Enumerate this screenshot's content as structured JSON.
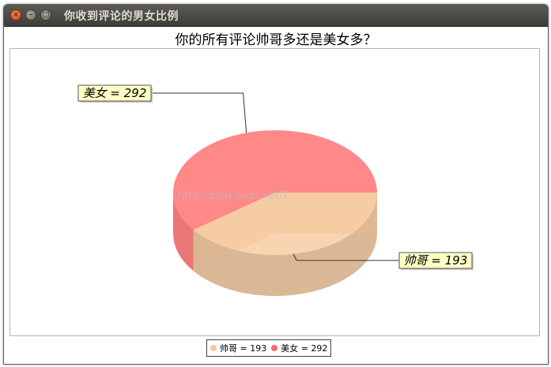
{
  "window": {
    "title": "你收到评论的男女比例",
    "controls": {
      "close": "×",
      "minimize": "–",
      "maximize": "□"
    }
  },
  "chart_data": {
    "type": "pie",
    "title": "你的所有评论帅哥多还是美女多？",
    "categories": [
      "帅哥",
      "美女"
    ],
    "values": [
      193,
      292
    ],
    "colors": [
      "#f7c89a",
      "#ff6a6a"
    ],
    "slice_labels": [
      "帅哥 = 193",
      "美女 = 292"
    ],
    "legend": {
      "placement": "bottom",
      "entries": [
        "帅哥 = 193",
        "美女 = 292"
      ]
    },
    "three_d": true,
    "watermark": "http://blog.csdn.net/T..."
  }
}
